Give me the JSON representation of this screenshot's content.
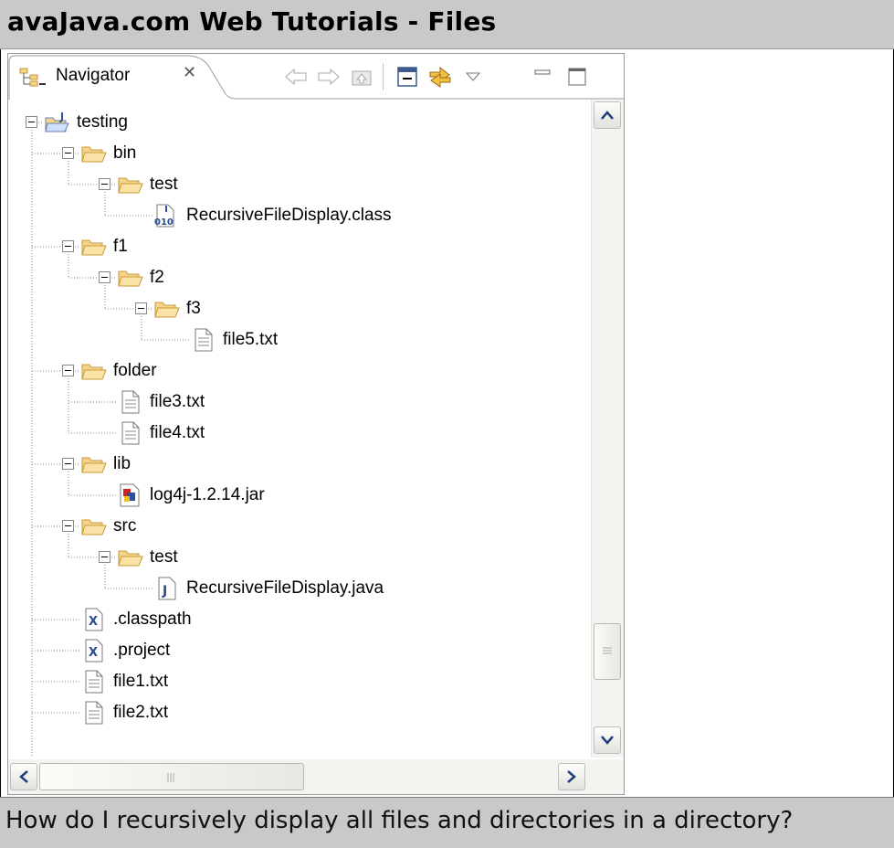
{
  "window": {
    "title": "avaJava.com Web Tutorials - Files"
  },
  "footer": {
    "caption": "How do I recursively display all files and directories in a directory?"
  },
  "navigator": {
    "tab_label": "Navigator",
    "tab_close_icon": "close-x-icon",
    "toolbar": [
      {
        "name": "back-button",
        "icon": "back-arrow-icon"
      },
      {
        "name": "forward-button",
        "icon": "forward-arrow-icon"
      },
      {
        "name": "up-button",
        "icon": "up-folder-icon"
      },
      {
        "name": "collapse-all-button",
        "icon": "collapse-all-icon"
      },
      {
        "name": "link-with-editor-button",
        "icon": "link-editor-icon"
      },
      {
        "name": "view-menu-button",
        "icon": "dropdown-triangle-icon"
      },
      {
        "name": "minimize-button",
        "icon": "minimize-icon"
      },
      {
        "name": "maximize-button",
        "icon": "maximize-icon"
      }
    ],
    "tree": [
      {
        "label": "testing",
        "type": "project",
        "depth": 0,
        "expanded": true
      },
      {
        "label": "bin",
        "type": "folder",
        "depth": 1,
        "expanded": true
      },
      {
        "label": "test",
        "type": "folder",
        "depth": 2,
        "expanded": true
      },
      {
        "label": "RecursiveFileDisplay.class",
        "type": "class",
        "depth": 3
      },
      {
        "label": "f1",
        "type": "folder",
        "depth": 1,
        "expanded": true
      },
      {
        "label": "f2",
        "type": "folder",
        "depth": 2,
        "expanded": true
      },
      {
        "label": "f3",
        "type": "folder",
        "depth": 3,
        "expanded": true
      },
      {
        "label": "file5.txt",
        "type": "text",
        "depth": 4
      },
      {
        "label": "folder",
        "type": "folder",
        "depth": 1,
        "expanded": true
      },
      {
        "label": "file3.txt",
        "type": "text",
        "depth": 2
      },
      {
        "label": "file4.txt",
        "type": "text",
        "depth": 2
      },
      {
        "label": "lib",
        "type": "folder",
        "depth": 1,
        "expanded": true
      },
      {
        "label": "log4j-1.2.14.jar",
        "type": "jar",
        "depth": 2
      },
      {
        "label": "src",
        "type": "folder",
        "depth": 1,
        "expanded": true
      },
      {
        "label": "test",
        "type": "folder",
        "depth": 2,
        "expanded": true
      },
      {
        "label": "RecursiveFileDisplay.java",
        "type": "java",
        "depth": 3
      },
      {
        "label": ".classpath",
        "type": "xml",
        "depth": 1
      },
      {
        "label": ".project",
        "type": "xml",
        "depth": 1
      },
      {
        "label": "file1.txt",
        "type": "text",
        "depth": 1
      },
      {
        "label": "file2.txt",
        "type": "text",
        "depth": 1
      }
    ],
    "vertical_scroll_fraction": 0.92,
    "horizontal_scroll_fraction": 0.0
  },
  "colors": {
    "title_bar_bg": "#c9c9c9",
    "folder_fill": "#f6d38a",
    "folder_stroke": "#c79a3a",
    "tree_connector": "#8a8a8a"
  }
}
